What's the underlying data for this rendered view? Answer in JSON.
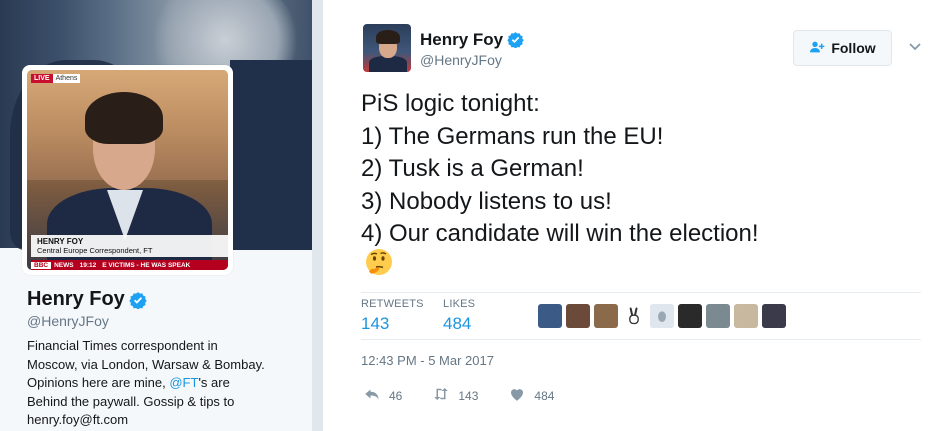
{
  "profile": {
    "name": "Henry Foy",
    "handle": "@HenryJFoy",
    "bio_lines": [
      "Financial Times correspondent in",
      "Moscow, via London, Warsaw & Bombay.",
      "Behind the paywall. Gossip & tips to",
      "henry.foy@ft.com"
    ],
    "bio_opinions_prefix": "Opinions here are mine, ",
    "bio_ft_link": "@FT",
    "bio_opinions_suffix": "'s are",
    "avatar_caption": {
      "live": "LIVE",
      "location": "Athens",
      "name": "HENRY FOY",
      "role": "Central Europe Correspondent, FT",
      "ticker_channel": "BBC",
      "ticker_news": "NEWS",
      "ticker_time": "19:12",
      "ticker_text": "E VICTIMS - HE WAS SPEAK"
    }
  },
  "tweet": {
    "author_name": "Henry Foy",
    "author_handle": "@HenryJFoy",
    "follow_label": "Follow",
    "lines": [
      "PiS logic tonight:",
      "1) The Germans run the EU!",
      "2) Tusk is a German!",
      "3) Nobody listens to us!",
      "4) Our candidate will win the election!"
    ],
    "emoji": "thinking-face",
    "stats": {
      "retweets_label": "RETWEETS",
      "retweets": "143",
      "likes_label": "LIKES",
      "likes": "484"
    },
    "liker_colors": [
      "#3b5a86",
      "#6b4a3a",
      "#8a6a4a",
      "#ffffff",
      "#dfe6ee",
      "#2a2a2a",
      "#7a8a90",
      "#c9b8a0",
      "#3a3a4a"
    ],
    "timestamp": "12:43 PM - 5 Mar 2017",
    "actions": {
      "replies": "46",
      "retweets": "143",
      "likes": "484"
    }
  },
  "colors": {
    "accent": "#1b95e0",
    "muted": "#657786",
    "text": "#14171a"
  }
}
